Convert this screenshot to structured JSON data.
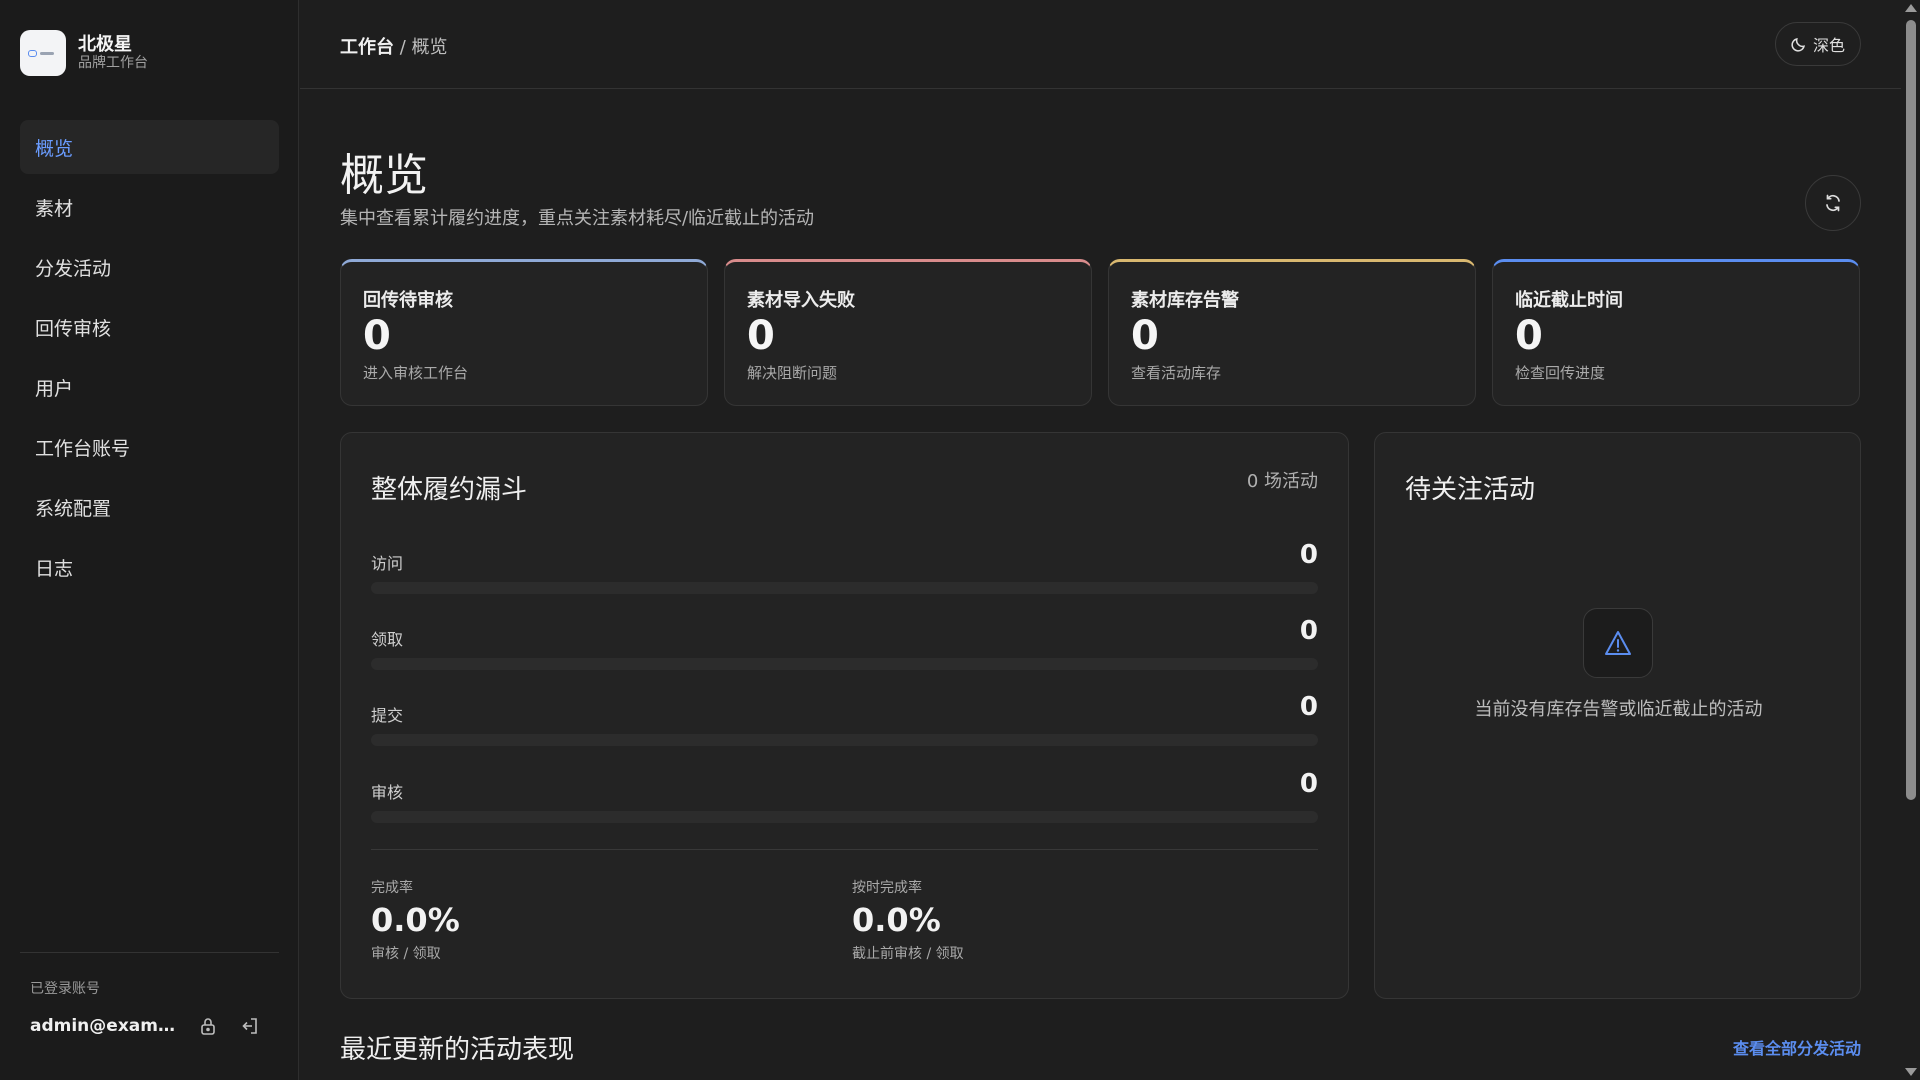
{
  "brand": {
    "name": "北极星",
    "subtitle": "品牌工作台"
  },
  "sidebar": {
    "items": [
      {
        "label": "概览",
        "active": true
      },
      {
        "label": "素材"
      },
      {
        "label": "分发活动"
      },
      {
        "label": "回传审核"
      },
      {
        "label": "用户"
      },
      {
        "label": "工作台账号"
      },
      {
        "label": "系统配置"
      },
      {
        "label": "日志"
      }
    ],
    "logged_in_label": "已登录账号",
    "account_email": "admin@exampl...",
    "lock_icon": "lock-icon",
    "logout_icon": "logout-icon"
  },
  "topbar": {
    "breadcrumb_root": "工作台",
    "breadcrumb_sep": " / ",
    "breadcrumb_current": "概览",
    "theme_label": "深色",
    "theme_icon": "moon-icon"
  },
  "page": {
    "title": "概览",
    "description": "集中查看累计履约进度，重点关注素材耗尽/临近截止的活动",
    "refresh_icon": "refresh-icon"
  },
  "stats": [
    {
      "label": "回传待审核",
      "value": "0",
      "hint": "进入审核工作台",
      "accent": "#8fa9d6"
    },
    {
      "label": "素材导入失败",
      "value": "0",
      "hint": "解决阻断问题",
      "accent": "#d98c8c"
    },
    {
      "label": "素材库存告警",
      "value": "0",
      "hint": "查看活动库存",
      "accent": "#d9b870"
    },
    {
      "label": "临近截止时间",
      "value": "0",
      "hint": "检查回传进度",
      "accent": "#5b8def"
    }
  ],
  "funnel": {
    "title": "整体履约漏斗",
    "meta": "0 场活动",
    "rows": [
      {
        "label": "访问",
        "value": "0",
        "progress": 0
      },
      {
        "label": "领取",
        "value": "0",
        "progress": 0
      },
      {
        "label": "提交",
        "value": "0",
        "progress": 0
      },
      {
        "label": "审核",
        "value": "0",
        "progress": 0
      }
    ],
    "completion": {
      "label": "完成率",
      "value": "0.0%",
      "sub": "审核 / 领取"
    },
    "ontime": {
      "label": "按时完成率",
      "value": "0.0%",
      "sub": "截止前审核 / 领取"
    }
  },
  "watch": {
    "title": "待关注活动",
    "empty_icon": "warning-icon",
    "empty_text": "当前没有库存告警或临近截止的活动"
  },
  "recent": {
    "title": "最近更新的活动表现",
    "view_all": "查看全部分发活动"
  },
  "colors": {
    "accent": "#5b8def",
    "background": "#1e1e1e",
    "card": "#232323"
  }
}
